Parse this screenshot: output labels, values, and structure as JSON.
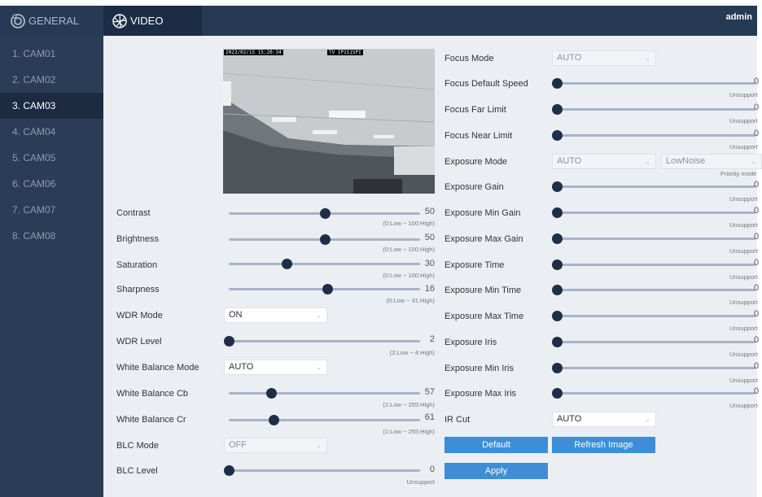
{
  "header": {
    "general_label": "GENERAL",
    "video_label": "VIDEO",
    "user": "admin"
  },
  "sidebar": {
    "items": [
      {
        "label": "1. CAM01"
      },
      {
        "label": "2. CAM02"
      },
      {
        "label": "3. CAM03"
      },
      {
        "label": "4. CAM04"
      },
      {
        "label": "5. CAM05"
      },
      {
        "label": "6. CAM06"
      },
      {
        "label": "7. CAM07"
      },
      {
        "label": "8. CAM08"
      }
    ],
    "active_index": 2
  },
  "preview": {
    "timestamp": "2023/02/15 15:20:34",
    "camera_id": "TV IP1515PI"
  },
  "left": {
    "contrast": {
      "label": "Contrast",
      "value": "50",
      "range": "(0:Low ~ 100:High)",
      "fraction": 0.5
    },
    "brightness": {
      "label": "Brightness",
      "value": "50",
      "range": "(0:Low ~ 100:High)",
      "fraction": 0.5
    },
    "saturation": {
      "label": "Saturation",
      "value": "30",
      "range": "(0:Low ~ 100:High)",
      "fraction": 0.3
    },
    "sharpness": {
      "label": "Sharpness",
      "value": "16",
      "range": "(0:Low ~ 31:High)",
      "fraction": 0.516
    },
    "wdr_mode": {
      "label": "WDR Mode",
      "value": "ON"
    },
    "wdr_level": {
      "label": "WDR Level",
      "value": "2",
      "range": "(2:Low ~ 4:High)",
      "fraction": 0.0
    },
    "wb_mode": {
      "label": "White Balance Mode",
      "value": "AUTO"
    },
    "wb_cb": {
      "label": "White Balance Cb",
      "value": "57",
      "range": "(1:Low ~ 255:High)",
      "fraction": 0.22
    },
    "wb_cr": {
      "label": "White Balance Cr",
      "value": "61",
      "range": "(1:Low ~ 255:High)",
      "fraction": 0.236
    },
    "blc_mode": {
      "label": "BLC Mode",
      "value": "OFF"
    },
    "blc_level": {
      "label": "BLC Level",
      "value": "0",
      "range": "Unsupport",
      "fraction": 0.0
    }
  },
  "right": {
    "focus_mode": {
      "label": "Focus Mode",
      "value": "AUTO"
    },
    "focus_default_speed": {
      "label": "Focus Default Speed",
      "value": "0",
      "range": "Unsupport"
    },
    "focus_far_limit": {
      "label": "Focus Far Limit",
      "value": "0",
      "range": "Unsupport"
    },
    "focus_near_limit": {
      "label": "Focus Near Limit",
      "value": "0",
      "range": "Unsupport"
    },
    "exposure_mode": {
      "label": "Exposure Mode",
      "value": "AUTO",
      "noise_value": "LowNoise",
      "note": "Priority mode"
    },
    "exposure_gain": {
      "label": "Exposure Gain",
      "value": "0",
      "range": "Unsupport"
    },
    "exposure_min_gain": {
      "label": "Exposure Min Gain",
      "value": "0",
      "range": "Unsupport"
    },
    "exposure_max_gain": {
      "label": "Exposure Max Gain",
      "value": "0",
      "range": "Unsupport"
    },
    "exposure_time": {
      "label": "Exposure Time",
      "value": "0",
      "range": "Unsupport"
    },
    "exposure_min_time": {
      "label": "Exposure Min Time",
      "value": "0",
      "range": "Unsupport"
    },
    "exposure_max_time": {
      "label": "Exposure Max Time",
      "value": "0",
      "range": "Unsupport"
    },
    "exposure_iris": {
      "label": "Exposure Iris",
      "value": "0",
      "range": "Unsupport"
    },
    "exposure_min_iris": {
      "label": "Exposure Min Iris",
      "value": "0",
      "range": "Unsupport"
    },
    "exposure_max_iris": {
      "label": "Exposure Max Iris",
      "value": "0",
      "range": "Unsupport"
    },
    "ir_cut": {
      "label": "IR Cut",
      "value": "AUTO"
    }
  },
  "buttons": {
    "default": "Default",
    "refresh": "Refresh Image",
    "apply": "Apply"
  },
  "colors": {
    "accent": "#3d8ed6",
    "header": "#273a55",
    "sidebar": "#2b3c57"
  }
}
